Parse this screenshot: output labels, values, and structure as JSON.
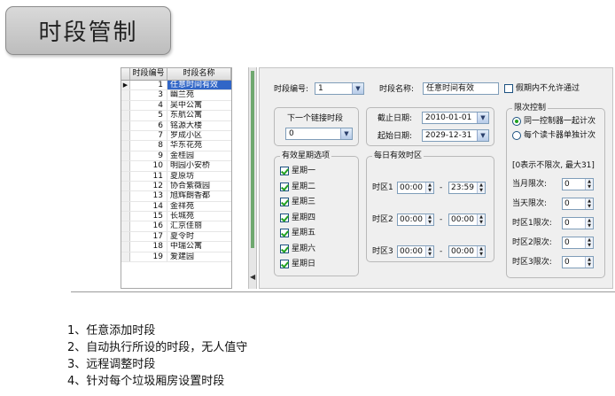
{
  "slide_title": "时段管制",
  "list": {
    "headers": [
      "时段编号",
      "时段名称"
    ],
    "rows": [
      {
        "id": "1",
        "name": "任意时间有效",
        "selected": true
      },
      {
        "id": "3",
        "name": "幽兰苑"
      },
      {
        "id": "4",
        "name": "吴中公寓"
      },
      {
        "id": "5",
        "name": "东航公寓"
      },
      {
        "id": "6",
        "name": "铭源大楼"
      },
      {
        "id": "7",
        "name": "罗成小区"
      },
      {
        "id": "8",
        "name": "华东花苑"
      },
      {
        "id": "9",
        "name": "金桂园"
      },
      {
        "id": "10",
        "name": "明园小安桥"
      },
      {
        "id": "11",
        "name": "夏原坊"
      },
      {
        "id": "12",
        "name": "协合紫薇园"
      },
      {
        "id": "13",
        "name": "旭辉朗香都"
      },
      {
        "id": "14",
        "name": "金祥苑"
      },
      {
        "id": "15",
        "name": "长城苑"
      },
      {
        "id": "16",
        "name": "汇京佳丽"
      },
      {
        "id": "17",
        "name": "夏令时"
      },
      {
        "id": "18",
        "name": "中瑞公寓"
      },
      {
        "id": "19",
        "name": "爱建园"
      }
    ]
  },
  "form": {
    "code_label": "时段编号:",
    "code_value": "1",
    "name_label": "时段名称:",
    "name_value": "任意时间有效",
    "holiday_label": "假期内不允许通过",
    "next_link_label": "下一个链接时段",
    "next_link_value": "0",
    "end_date_label": "截止日期:",
    "end_date_value": "2010-01-01",
    "start_date_label": "起始日期:",
    "start_date_value": "2029-12-31",
    "weekday_group_title": "有效星期选项",
    "weekdays": [
      "星期一",
      "星期二",
      "星期三",
      "星期四",
      "星期五",
      "星期六",
      "星期日"
    ],
    "daily_group_title": "每日有效时区",
    "zones": [
      {
        "label": "时区1",
        "start": "00:00",
        "end": "23:59"
      },
      {
        "label": "时区2",
        "start": "00:00",
        "end": "00:00"
      },
      {
        "label": "时区3",
        "start": "00:00",
        "end": "00:00"
      }
    ],
    "dash": "-",
    "limit_group_title": "限次控制",
    "limit_options": [
      "同一控制器一起计次",
      "每个读卡器单独计次"
    ],
    "limit_note": "[0表示不限次, 最大31]",
    "limits": [
      {
        "label": "当月限次:",
        "value": "0"
      },
      {
        "label": "当天限次:",
        "value": "0"
      },
      {
        "label": "时区1限次:",
        "value": "0"
      },
      {
        "label": "时区2限次:",
        "value": "0"
      },
      {
        "label": "时区3限次:",
        "value": "0"
      }
    ]
  },
  "notes": [
    "1、任意添加时段",
    "2、自动执行所设的时段，无人值守",
    "3、远程调整时段",
    "4、针对每个垃圾厢房设置时段"
  ]
}
